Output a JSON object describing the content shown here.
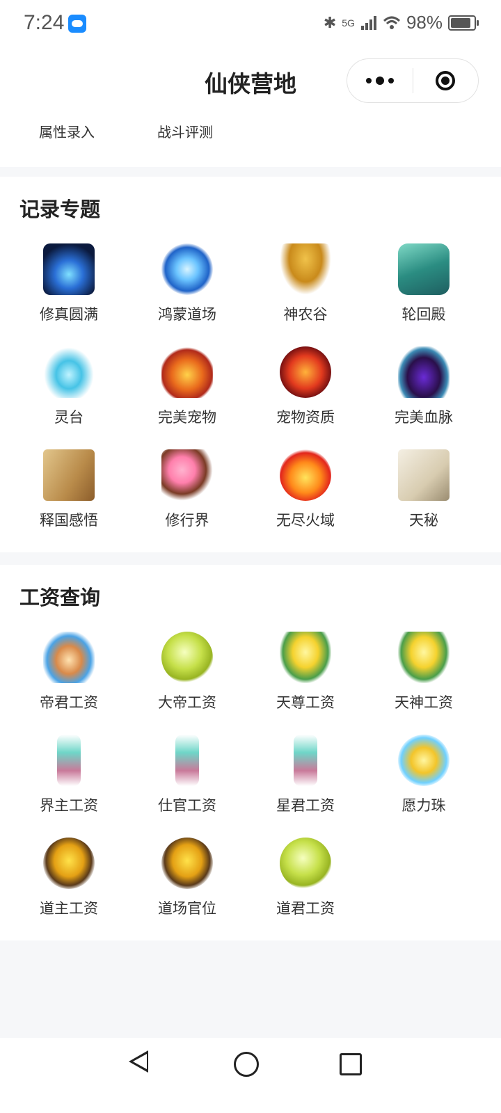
{
  "status": {
    "time": "7:24",
    "battery": "98%",
    "network": "5G"
  },
  "header": {
    "title": "仙侠营地"
  },
  "topnav": {
    "items": [
      "属性录入",
      "战斗评测"
    ]
  },
  "sections": {
    "records": {
      "title": "记录专题",
      "items": [
        "修真圆满",
        "鸿蒙道场",
        "神农谷",
        "轮回殿",
        "灵台",
        "完美宠物",
        "宠物资质",
        "完美血脉",
        "释国感悟",
        "修行界",
        "无尽火域",
        "天秘"
      ]
    },
    "salary": {
      "title": "工资查询",
      "items": [
        "帝君工资",
        "大帝工资",
        "天尊工资",
        "天神工资",
        "界主工资",
        "仕官工资",
        "星君工资",
        "愿力珠",
        "道主工资",
        "道场官位",
        "道君工资"
      ]
    }
  },
  "icons": {
    "records": [
      "meditation-figure-icon",
      "vortex-portal-icon",
      "golden-tree-icon",
      "jade-seal-icon",
      "water-swirl-icon",
      "phoenix-icon",
      "fire-egg-icon",
      "dark-flame-icon",
      "ancient-book-icon",
      "plum-blossom-tree-icon",
      "fire-orb-icon",
      "open-scroll-book-icon"
    ],
    "salary": [
      "ornate-vase-icon",
      "star-orb-icon",
      "golden-flame-icon",
      "golden-flame-icon",
      "crystal-sword-icon",
      "crystal-sword-icon",
      "crystal-sword-icon",
      "energy-sphere-icon",
      "golden-fire-nest-icon",
      "golden-fire-nest-icon",
      "star-orb-icon"
    ]
  }
}
